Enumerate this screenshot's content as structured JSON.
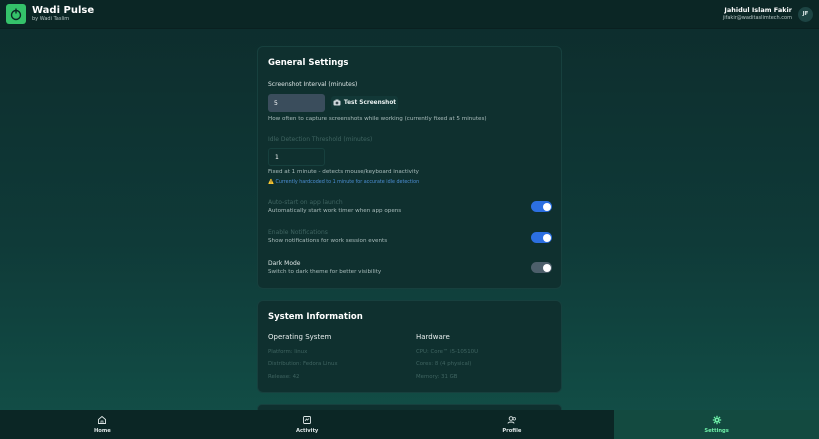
{
  "header": {
    "app_name": "Wadi Pulse",
    "app_sub": "by Wadi Taslim",
    "user_name": "Jahidul Islam Fakir",
    "user_email": "jifakir@waditaslimtech.com",
    "avatar_initials": "JF"
  },
  "general": {
    "title": "General Settings",
    "screenshot_label": "Screenshot Interval (minutes)",
    "screenshot_value": "5",
    "test_button": "Test Screenshot",
    "test_icon": "camera-icon",
    "screenshot_hint": "How often to capture screenshots while working (currently fixed at 5 minutes)",
    "idle_label": "Idle Detection Threshold (minutes)",
    "idle_value": "1",
    "idle_hint": "Fixed at 1 minute - detects mouse/keyboard inactivity",
    "idle_warning": "⚠️ Currently hardcoded to 1 minute for accurate idle detection",
    "autostart_label": "Auto-start on app launch",
    "autostart_hint": "Automatically start work timer when app opens",
    "autostart_on": true,
    "notifications_label": "Enable Notifications",
    "notifications_hint": "Show notifications for work session events",
    "notifications_on": true,
    "darkmode_label": "Dark Mode",
    "darkmode_hint": "Switch to dark theme for better visibility",
    "darkmode_on": true
  },
  "system": {
    "title": "System Information",
    "os_title": "Operating System",
    "os_items": [
      "Platform: linux",
      "Distribution: Fedora Linux",
      "Release: 42"
    ],
    "hw_title": "Hardware",
    "hw_items": [
      "CPU: Core™ i5-10510U",
      "Cores: 8 (4 physical)",
      "Memory: 31 GB"
    ]
  },
  "nav": {
    "items": [
      {
        "label": "Home",
        "icon": "home-icon"
      },
      {
        "label": "Activity",
        "icon": "activity-icon"
      },
      {
        "label": "Profile",
        "icon": "profile-icon"
      },
      {
        "label": "Settings",
        "icon": "gear-icon"
      }
    ],
    "active": "Settings"
  },
  "colors": {
    "accent_green": "#34c26a",
    "toggle_on": "#2c6fe0",
    "active_nav": "#6ff0a8"
  }
}
